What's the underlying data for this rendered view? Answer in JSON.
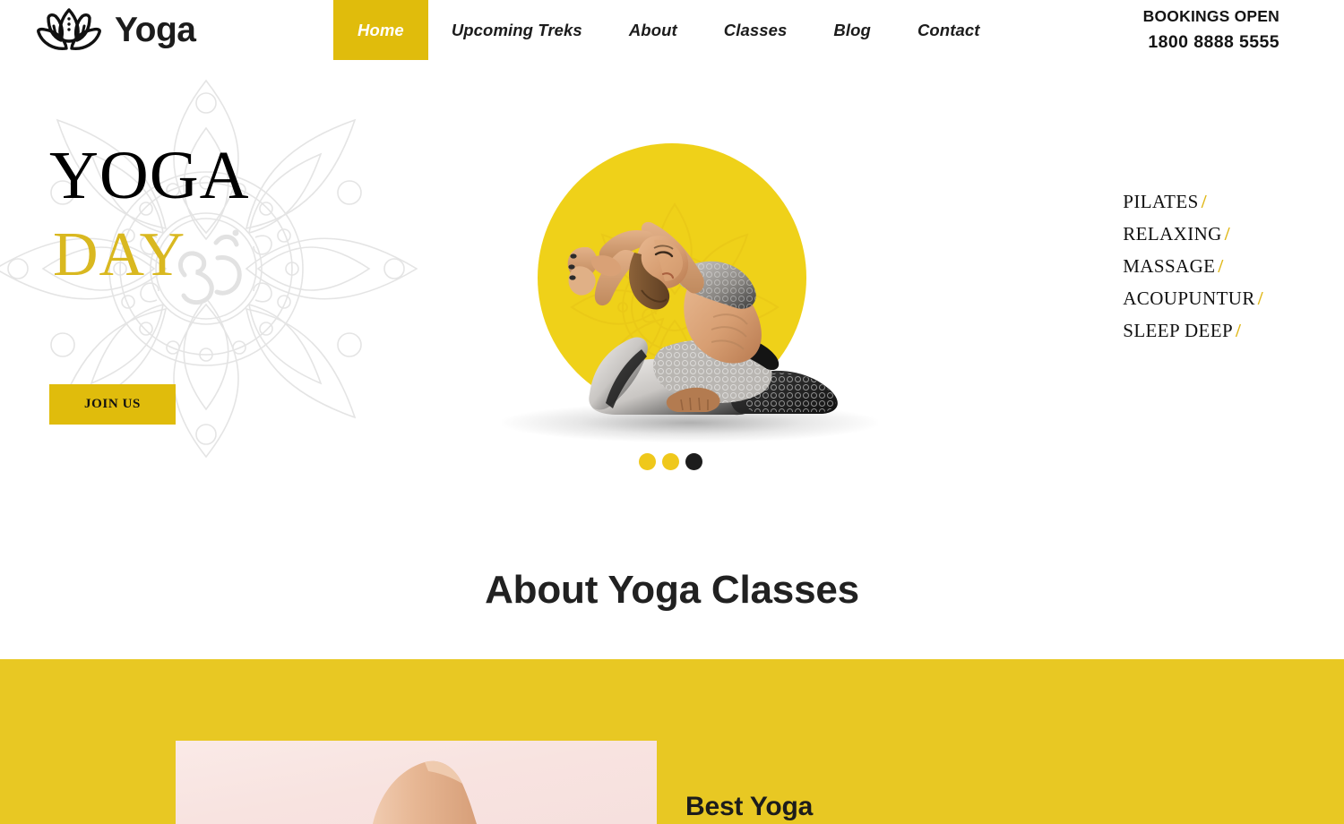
{
  "brand": {
    "name": "Yoga",
    "logo_icon": "lotus-icon"
  },
  "nav": {
    "items": [
      {
        "label": "Home",
        "active": true
      },
      {
        "label": "Upcoming Treks",
        "active": false
      },
      {
        "label": "About",
        "active": false
      },
      {
        "label": "Classes",
        "active": false
      },
      {
        "label": "Blog",
        "active": false
      },
      {
        "label": "Contact",
        "active": false
      }
    ]
  },
  "bookings": {
    "label": "BOOKINGS OPEN",
    "phone": "1800 8888 5555"
  },
  "hero": {
    "title": "YOGA",
    "subtitle": "DAY",
    "cta_label": "JOIN US",
    "figure_alt": "woman-in-king-pigeon-yoga-pose",
    "carousel": {
      "dots": [
        {
          "active": false
        },
        {
          "active": false
        },
        {
          "active": true
        }
      ]
    }
  },
  "services": {
    "items": [
      {
        "label": "PILATES",
        "separator": "/"
      },
      {
        "label": "RELAXING",
        "separator": "/"
      },
      {
        "label": "MASSAGE",
        "separator": "/"
      },
      {
        "label": "ACOUPUNTUR",
        "separator": "/"
      },
      {
        "label": "SLEEP DEEP",
        "separator": "/"
      }
    ]
  },
  "about": {
    "heading": "About Yoga Classes"
  },
  "best": {
    "title": "Best Yoga",
    "image_alt": "yoga-pose-on-pink-background"
  },
  "colors": {
    "accent_gold": "#E0BC0C",
    "band_yellow": "#E8C823",
    "circle_yellow": "#EFD119",
    "dot_yellow": "#EFC81B",
    "serif_gold": "#D9B820",
    "dark": "#1c1c1c",
    "white": "#ffffff",
    "watermark_gray": "#E6E6E6",
    "card_pink": "#F9E7E4"
  }
}
